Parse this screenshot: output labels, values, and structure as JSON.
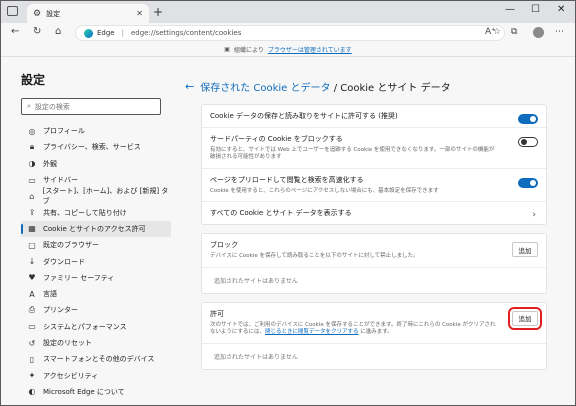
{
  "tab": {
    "title": "設定"
  },
  "address": {
    "brand": "Edge",
    "url": "edge://settings/content/cookies"
  },
  "managed": {
    "prefix": "組織により",
    "link": "ブラウザーは管理されています"
  },
  "sidebar": {
    "title": "設定",
    "search_placeholder": "設定の検索",
    "items": [
      {
        "label": "プロフィール",
        "icon": "profile-icon"
      },
      {
        "label": "プライバシー、検索、サービス",
        "icon": "lock-icon"
      },
      {
        "label": "外観",
        "icon": "appearance-icon"
      },
      {
        "label": "サイドバー",
        "icon": "sidebar-icon"
      },
      {
        "label": "[スタート]、[ホーム]、および [新規] タブ",
        "icon": "home-icon"
      },
      {
        "label": "共有、コピーして貼り付け",
        "icon": "share-icon"
      },
      {
        "label": "Cookie とサイトのアクセス許可",
        "icon": "cookie-icon"
      },
      {
        "label": "既定のブラウザー",
        "icon": "browser-icon"
      },
      {
        "label": "ダウンロード",
        "icon": "download-icon"
      },
      {
        "label": "ファミリー セーフティ",
        "icon": "family-icon"
      },
      {
        "label": "言語",
        "icon": "language-icon"
      },
      {
        "label": "プリンター",
        "icon": "printer-icon"
      },
      {
        "label": "システムとパフォーマンス",
        "icon": "system-icon"
      },
      {
        "label": "設定のリセット",
        "icon": "reset-icon"
      },
      {
        "label": "スマートフォンとその他のデバイス",
        "icon": "phone-icon"
      },
      {
        "label": "アクセシビリティ",
        "icon": "accessibility-icon"
      },
      {
        "label": "Microsoft Edge について",
        "icon": "edge-icon"
      }
    ]
  },
  "main": {
    "breadcrumb_link": "保存された Cookie とデータ",
    "breadcrumb_sep": " / ",
    "breadcrumb_current": "Cookie とサイト データ",
    "settings": [
      {
        "title": "Cookie データの保存と読み取りをサイトに許可する (推奨)",
        "desc": "",
        "toggle": "on"
      },
      {
        "title": "サードパーティの Cookie をブロックする",
        "desc": "有効にすると、サイトでは Web 上でユーザーを追跡する Cookie を使用できなくなります。一部のサイトの機能が破損される可能性があります",
        "toggle": "off"
      },
      {
        "title": "ページをプリロードして閲覧と検索を高速化する",
        "desc": "Cookie を使用すると、これらのページにアクセスしない場合にも、基本設定を保存できます",
        "toggle": "on"
      },
      {
        "title": "すべての Cookie とサイト データを表示する",
        "desc": "",
        "toggle": "chevron"
      }
    ],
    "block": {
      "title": "ブロック",
      "desc": "デバイスに Cookie を保存して読み取ることを以下のサイトに対して禁止しました。",
      "add": "追加",
      "empty": "追加されたサイトはありません"
    },
    "allow": {
      "title": "許可",
      "desc_prefix": "次のサイトでは、ご利用のデバイスに Cookie を保存することができます。終了時にこれらの Cookie がクリアされないようにするには、",
      "desc_link": "閉じるときに閲覧データをクリアする",
      "desc_suffix": " に進みます。",
      "add": "追加",
      "empty": "追加されたサイトはありません"
    }
  }
}
